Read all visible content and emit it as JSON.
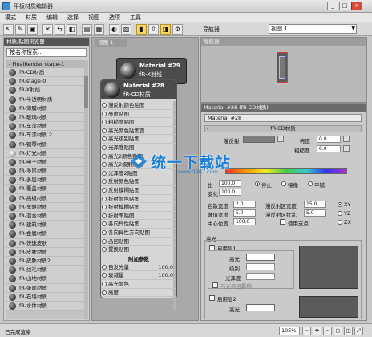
{
  "window": {
    "title": "平板材质编辑器",
    "min": "_",
    "max": "□",
    "close": "×"
  },
  "menu": [
    "模式",
    "材质",
    "编辑",
    "选择",
    "视图",
    "选项",
    "工具"
  ],
  "toolbar": {
    "view_label": "导航器",
    "view_select": "视图 1"
  },
  "left_panel": {
    "header": "材质/贴图浏览器",
    "search_placeholder": "按名称搜索...",
    "group": "- FinalRender stage-1",
    "items": [
      "fR-CD材质",
      "fR-stage-0",
      "fR-X射线",
      "fR-半透明材质",
      "fR-薄膜材质",
      "fR-玻璃材质",
      "fR-车漆材质",
      "fR-车漆材质 2",
      "fR-钢琴材质",
      "fR-灯光材质",
      "fR-电子材质",
      "fR-多层材质",
      "fR-多层材质",
      "fR-覆盖材质",
      "fR-高级材质",
      "fR-鬼魅材质",
      "fR-混合材质",
      "fR-建筑材质",
      "fR-金属材质",
      "fR-快速皮肤",
      "fR-皮肤材质",
      "fR-皮肤材质2",
      "fR-绒毛材质",
      "fR-山地材质",
      "fR-蛋面材质",
      "fR-石墙材质",
      "fR-水体材质"
    ],
    "light_items": [
      9
    ]
  },
  "canvas": {
    "tab": "视图 1",
    "node29": {
      "title": "Material #29",
      "subtitle": "fR-X射线"
    },
    "node28": {
      "title": "Material #28",
      "subtitle": "fR-CD材质",
      "slots": [
        "漫反射颜色贴图",
        "亮度贴图",
        "粗糙度贴图",
        "高光颜色贴图置",
        "高光级别贴图",
        "光泽度贴图",
        "高光2颜色贴图",
        "高光2级别贴图",
        "光泽度2贴图",
        "反射颜色贴图",
        "反射模糊贴图",
        "折射颜色贴图",
        "折射模糊贴图",
        "折射率贴图",
        "各向异性贴图",
        "各向异性方向贴图",
        "凸凹贴图",
        "置换贴图"
      ],
      "extra": "附加参数",
      "params": [
        {
          "label": "自发光量",
          "value": "100.0"
        },
        {
          "label": "衰减量",
          "value": "100.0"
        },
        {
          "label": "高光颜色",
          "value": ""
        },
        {
          "label": "亮度",
          "value": ""
        }
      ]
    }
  },
  "navigator": {
    "header": "导航器"
  },
  "props": {
    "header": "Material #28 (fR-CD材质)",
    "name": "Material #28",
    "rollout": "fR-CD材质",
    "diffuse_label": "漫反射",
    "brightness_label": "亮度",
    "brightness_value": "0.0",
    "roughness_label": "粗糙度",
    "roughness_value": "0.0",
    "row1": {
      "label": "比",
      "value": "100.0"
    },
    "row2": {
      "label": "变化",
      "value": "100.0"
    },
    "radios_a": [
      "停止",
      "镜像",
      "平铺"
    ],
    "color_width_label": "色散宽度",
    "color_width": "2.0",
    "peak_width_label": "峰值宽度",
    "peak_width": "5.0",
    "center_label": "中心位置",
    "center": "100.0",
    "diff_width_label": "漫反射区宽度",
    "diff_width": "15.0",
    "diff_strength_label": "漫反射区扰乱",
    "diff_strength": "5.0",
    "use_vertex_label": "使用支点",
    "axes": [
      "XY",
      "YZ",
      "ZX"
    ],
    "specular_group": "高光",
    "layer1": "启用层1",
    "spec_label": "高光",
    "level_label": "级别",
    "gloss_label": "光泽度",
    "glossy_layer_label": "与光亮层影响",
    "layer2": "启用层2",
    "spec2_label": "高光"
  },
  "watermark": {
    "text": "统一下载站",
    "url": "www.3987.com"
  },
  "status": {
    "text": "已完成渲染",
    "zoom": "105%"
  },
  "colors": {
    "accent": "#1d7fd8",
    "node_header": "#4c4c4c",
    "active_toggle": "#f6d66a"
  }
}
